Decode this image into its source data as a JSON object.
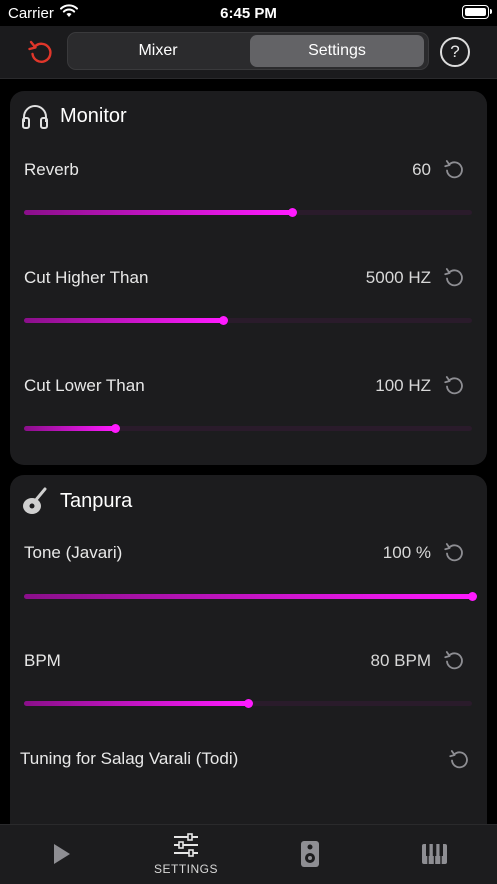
{
  "status_bar": {
    "carrier": "Carrier",
    "time": "6:45 PM"
  },
  "nav": {
    "segments": [
      {
        "label": "Mixer",
        "selected": false
      },
      {
        "label": "Settings",
        "selected": true
      }
    ],
    "help_label": "?",
    "reset_icon": "undo-icon"
  },
  "monitor": {
    "title": "Monitor",
    "icon": "headphones-icon",
    "rows": [
      {
        "label": "Reverb",
        "value": "60",
        "level": 0.6
      },
      {
        "label": "Cut Higher Than",
        "value": "5000 HZ",
        "level": 0.445
      },
      {
        "label": "Cut Lower Than",
        "value": "100 HZ",
        "level": 0.205
      }
    ]
  },
  "tanpura": {
    "title": "Tanpura",
    "icon": "tanpura-icon",
    "rows": [
      {
        "label": "Tone (Javari)",
        "value": "100 %",
        "level": 1.0
      },
      {
        "label": "BPM",
        "value": "80 BPM",
        "level": 0.5
      },
      {
        "label": "Tuning for Salag Varali (Todi)",
        "value": ""
      }
    ]
  },
  "tab_bar": {
    "items": [
      {
        "icon": "play-icon",
        "label": ""
      },
      {
        "icon": "sliders-icon",
        "label": "SETTINGS"
      },
      {
        "icon": "speaker-icon",
        "label": ""
      },
      {
        "icon": "piano-icon",
        "label": ""
      }
    ]
  },
  "colors": {
    "accent": "#ff1aff",
    "reset_red": "#e0362a"
  }
}
